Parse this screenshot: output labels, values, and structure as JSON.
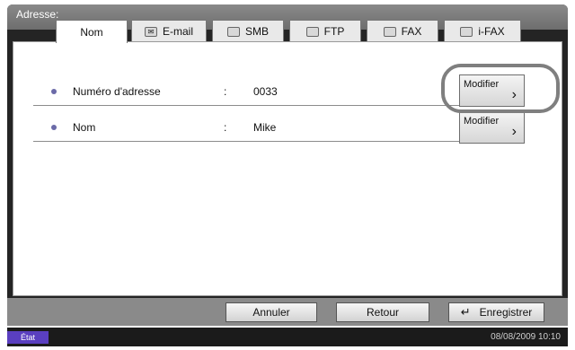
{
  "header": {
    "title": "Adresse:"
  },
  "tabs": [
    {
      "label": "Nom",
      "icon": "none",
      "active": true
    },
    {
      "label": "E-mail",
      "icon": "email-icon",
      "active": false
    },
    {
      "label": "SMB",
      "icon": "folder-icon",
      "active": false
    },
    {
      "label": "FTP",
      "icon": "folder-icon",
      "active": false
    },
    {
      "label": "FAX",
      "icon": "fax-icon",
      "active": false
    },
    {
      "label": "i-FAX",
      "icon": "ifax-icon",
      "active": false
    }
  ],
  "fields": [
    {
      "label": "Numéro d'adresse",
      "separator": ":",
      "value": "0033",
      "button_label": "Modifier",
      "button_icon": "chevron-right-icon"
    },
    {
      "label": "Nom",
      "separator": ":",
      "value": "Mike",
      "button_label": "Modifier",
      "button_icon": "chevron-right-icon"
    }
  ],
  "buttons": {
    "cancel": "Annuler",
    "back": "Retour",
    "save": "Enregistrer"
  },
  "status": {
    "label": "État",
    "datetime": "08/08/2009   10:10"
  },
  "colors": {
    "status_accent": "#5a3fc0",
    "bullet": "#6b6aa8",
    "highlight_ring": "#7f7f7f"
  }
}
